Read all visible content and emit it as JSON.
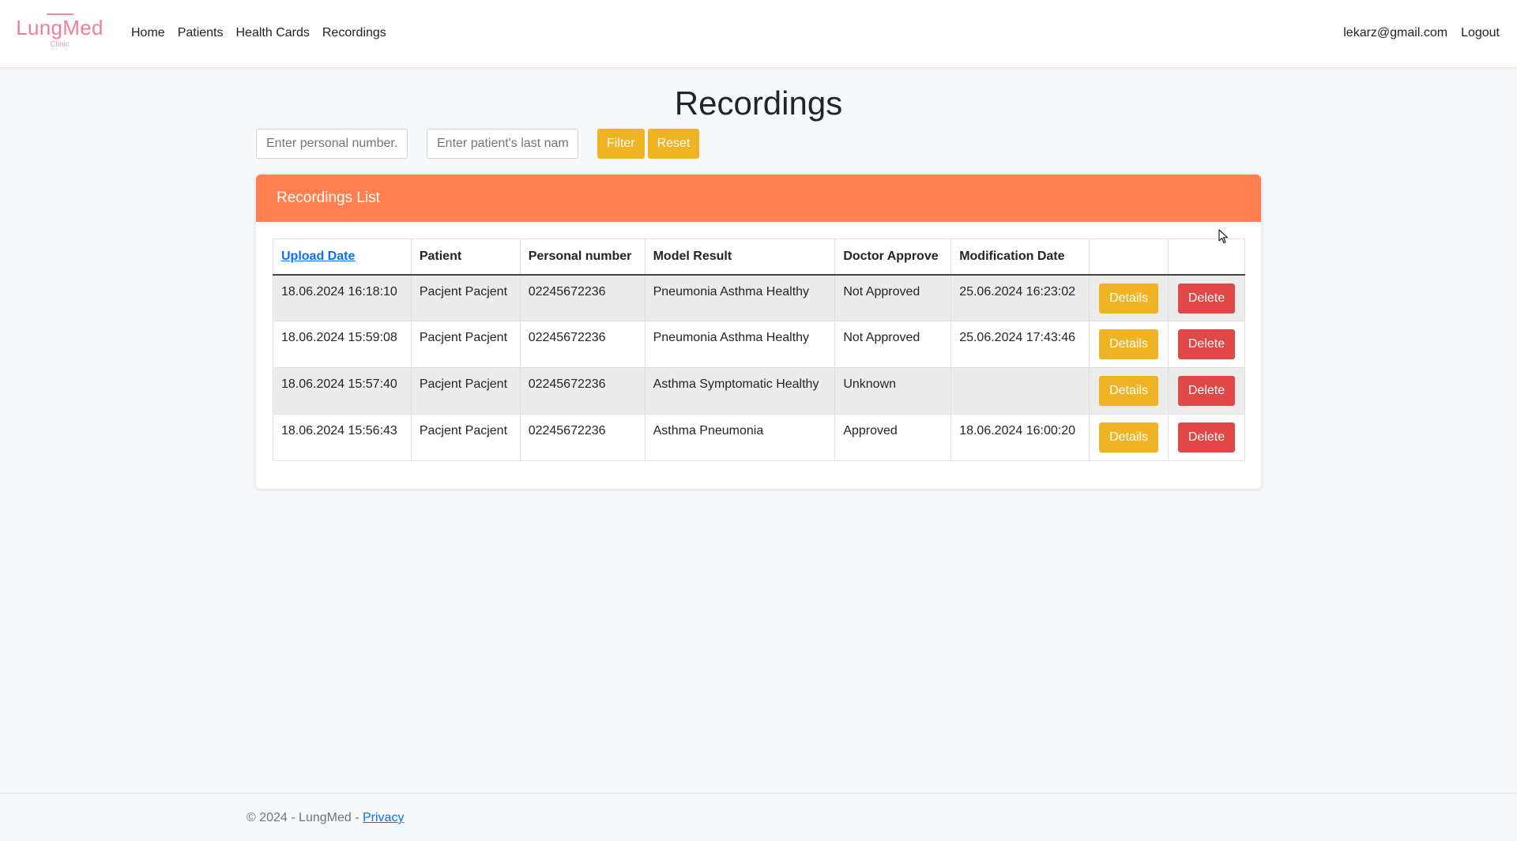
{
  "brand": {
    "name": "LungMed",
    "sub": "Clinic"
  },
  "nav": {
    "links": [
      "Home",
      "Patients",
      "Health Cards",
      "Recordings"
    ],
    "user_email": "lekarz@gmail.com",
    "logout": "Logout"
  },
  "page": {
    "title": "Recordings"
  },
  "filter": {
    "personal_placeholder": "Enter personal number...",
    "lastname_placeholder": "Enter patient's last name",
    "filter_label": "Filter",
    "reset_label": "Reset"
  },
  "card": {
    "title": "Recordings List"
  },
  "table": {
    "headers": [
      "Upload Date",
      "Patient",
      "Personal number",
      "Model Result",
      "Doctor Approve",
      "Modification Date",
      "",
      ""
    ],
    "details_label": "Details",
    "delete_label": "Delete",
    "rows": [
      {
        "upload": "18.06.2024 16:18:10",
        "patient": "Pacjent Pacjent",
        "personal": "02245672236",
        "result": "Pneumonia Asthma Healthy",
        "approve": "Not Approved",
        "modified": "25.06.2024 16:23:02"
      },
      {
        "upload": "18.06.2024 15:59:08",
        "patient": "Pacjent Pacjent",
        "personal": "02245672236",
        "result": "Pneumonia Asthma Healthy",
        "approve": "Not Approved",
        "modified": "25.06.2024 17:43:46"
      },
      {
        "upload": "18.06.2024 15:57:40",
        "patient": "Pacjent Pacjent",
        "personal": "02245672236",
        "result": "Asthma Symptomatic Healthy",
        "approve": "Unknown",
        "modified": ""
      },
      {
        "upload": "18.06.2024 15:56:43",
        "patient": "Pacjent Pacjent",
        "personal": "02245672236",
        "result": "Asthma Pneumonia",
        "approve": "Approved",
        "modified": "18.06.2024 16:00:20"
      }
    ]
  },
  "footer": {
    "text": "© 2024 - LungMed - ",
    "privacy": "Privacy"
  },
  "colors": {
    "accent": "#ff7f50",
    "yellow_button": "#f0b323",
    "red_button": "#e14747",
    "logo_pink": "#ef7f96"
  }
}
